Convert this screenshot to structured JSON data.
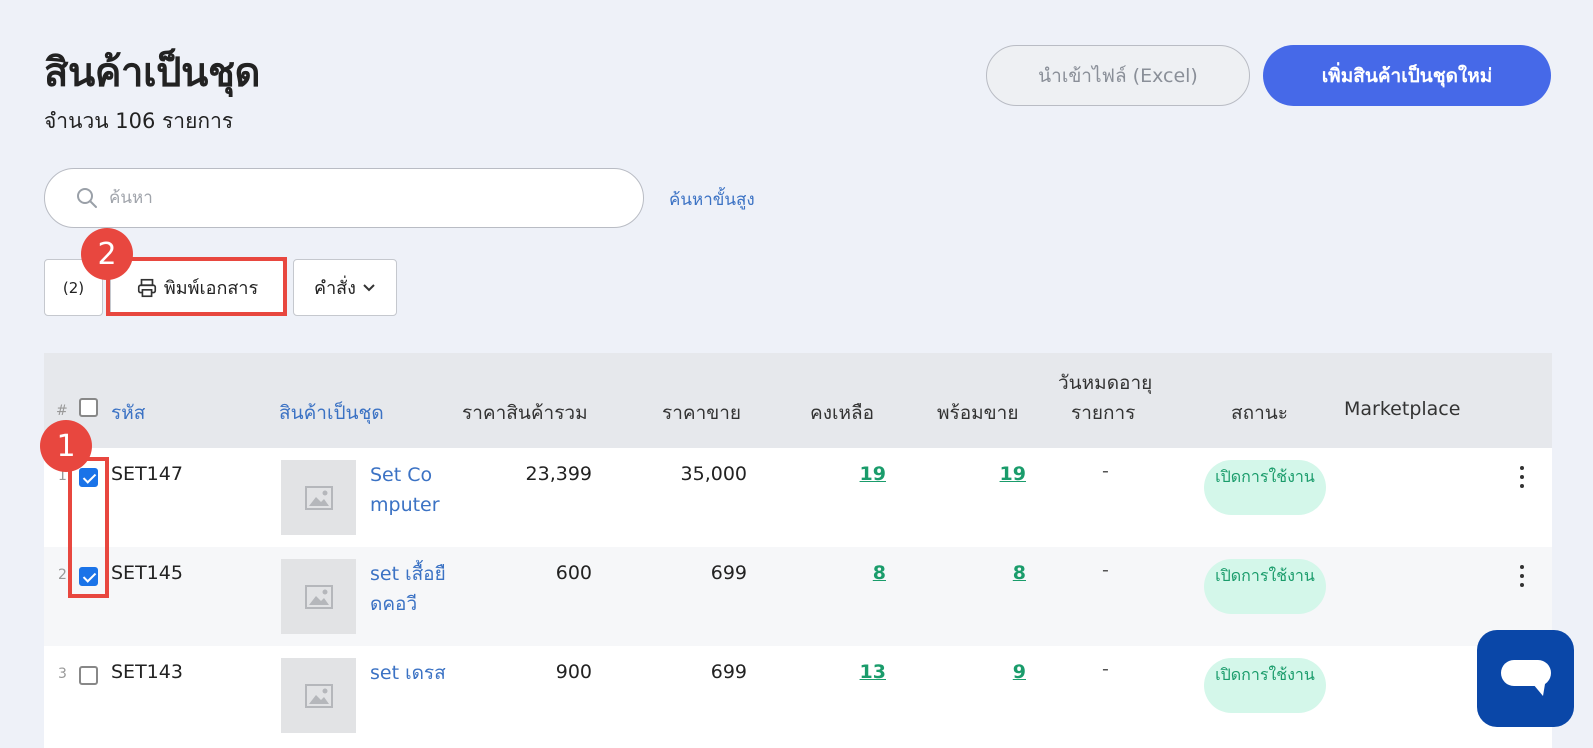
{
  "header": {
    "title": "สินค้าเป็นชุด",
    "count_text": "จำนวน 106 รายการ",
    "import_label": "นำเข้าไฟล์ (Excel)",
    "add_label": "เพิ่มสินค้าเป็นชุดใหม่"
  },
  "search": {
    "placeholder": "ค้นหา",
    "advanced_label": "ค้นหาขั้นสูง"
  },
  "toolbar": {
    "selected_count": "(2)",
    "print_label": "พิมพ์เอกสาร",
    "command_label": "คำสั่ง"
  },
  "annotations": {
    "step1": "1",
    "step2": "2"
  },
  "table": {
    "columns": {
      "hash": "#",
      "code": "รหัส",
      "product": "สินค้าเป็นชุด",
      "total_price": "ราคาสินค้ารวม",
      "sell_price": "ราคาขาย",
      "remaining": "คงเหลือ",
      "ready": "พร้อมขาย",
      "expiry_line1": "วันหมดอายุ",
      "expiry_line2": "รายการ",
      "status": "สถานะ",
      "marketplace": "Marketplace"
    },
    "rows": [
      {
        "num": "1",
        "checked": true,
        "code": "SET147",
        "name": "Set Computer",
        "total_price": "23,399",
        "sell_price": "35,000",
        "remaining": "19",
        "ready": "19",
        "expiry": "-",
        "status": "เปิดการใช้งาน"
      },
      {
        "num": "2",
        "checked": true,
        "code": "SET145",
        "name": "set เสื้อยืดคอวี",
        "total_price": "600",
        "sell_price": "699",
        "remaining": "8",
        "ready": "8",
        "expiry": "-",
        "status": "เปิดการใช้งาน"
      },
      {
        "num": "3",
        "checked": false,
        "code": "SET143",
        "name": "set เดรส",
        "total_price": "900",
        "sell_price": "699",
        "remaining": "13",
        "ready": "9",
        "expiry": "-",
        "status": "เปิดการใช้งาน"
      }
    ]
  },
  "colors": {
    "primary": "#4669e8",
    "highlight": "#e8473f",
    "status_bg": "#d4f7ea",
    "status_text": "#1a9c6b",
    "link": "#3b72c4",
    "chat": "#0a47a8"
  },
  "icons": {
    "search": "search-icon",
    "print": "printer-icon",
    "dropdown": "chevron-down-icon",
    "image": "image-placeholder-icon",
    "more": "kebab-menu-icon",
    "chat": "chat-icon"
  }
}
